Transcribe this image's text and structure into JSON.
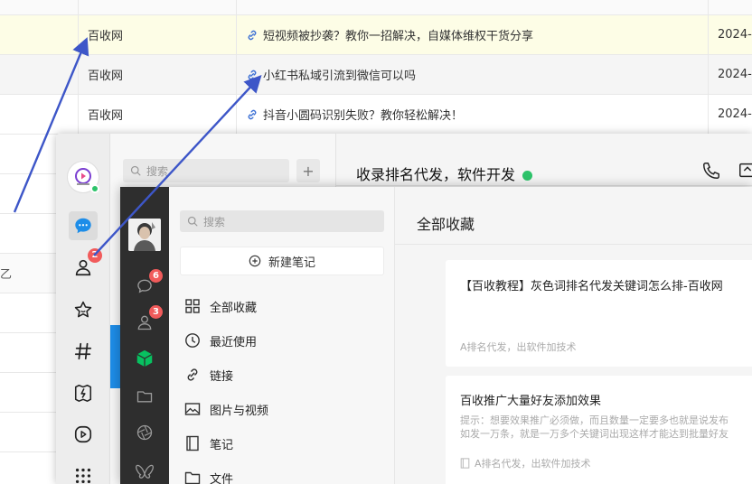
{
  "table": {
    "rows": [
      {
        "site": "百收网",
        "title": "短视频被抄袭？教你一招解决，自媒体维权干货分享",
        "date": "2024-",
        "highlight": true
      },
      {
        "site": "百收网",
        "title": "小红书私域引流到微信可以吗",
        "date": "2024-",
        "highlight": false
      },
      {
        "site": "百收网",
        "title": "抖音小圆码识别失败？教你轻松解决！",
        "date": "2024-",
        "highlight": false
      }
    ],
    "left_stub_char": "乙"
  },
  "chat_window": {
    "search_placeholder": "搜索",
    "plus_label": "+",
    "chat_title": "收录排名代发，软件开发",
    "sidebar": {
      "contacts_badge": "2",
      "items": [
        "chat-icon",
        "contacts-icon",
        "favorites-icon",
        "channels-icon",
        "moments-icon",
        "video-icon",
        "mini-program-icon"
      ]
    }
  },
  "favorites": {
    "search_placeholder": "搜索",
    "new_note": "新建笔记",
    "menu": [
      {
        "label": "全部收藏",
        "icon": "grid-icon"
      },
      {
        "label": "最近使用",
        "icon": "clock-icon"
      },
      {
        "label": "链接",
        "icon": "link-icon"
      },
      {
        "label": "图片与视频",
        "icon": "image-icon"
      },
      {
        "label": "笔记",
        "icon": "note-icon"
      },
      {
        "label": "文件",
        "icon": "folder-icon"
      }
    ],
    "dark_bar_badges": {
      "chat": "6",
      "contacts": "3"
    },
    "right_title": "全部收藏",
    "cards": [
      {
        "title": "【百收教程】灰色词排名代发关键词怎么排-百收网",
        "desc": "",
        "tag": "A排名代发，出软件加技术"
      },
      {
        "title": "百收推广大量好友添加效果",
        "desc_line1": "提示：想要效果推广必须做，而且数量一定要多也就是说发布",
        "desc_line2": "如发一万条，就是一万多个关键词出现这样才能达到批量好友",
        "tag": "A排名代发，出软件加技术"
      }
    ]
  },
  "colors": {
    "highlight_row": "#fdfde6",
    "arrow": "#3d56c8",
    "badge": "#f15b5b",
    "online": "#2dc36a",
    "accent_blue": "#1d8de8",
    "wechat_green": "#07c160"
  }
}
